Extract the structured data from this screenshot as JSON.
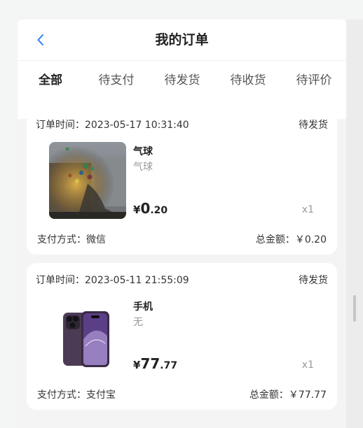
{
  "header": {
    "title": "我的订单",
    "back_icon": "chevron-left-icon"
  },
  "tabs": [
    {
      "label": "全部",
      "active": true
    },
    {
      "label": "待支付",
      "active": false
    },
    {
      "label": "待发货",
      "active": false
    },
    {
      "label": "待收货",
      "active": false
    },
    {
      "label": "待评价",
      "active": false
    }
  ],
  "orders": [
    {
      "time": "订单时间：2023-05-17 10:31:40",
      "status": "待发货",
      "product_name": "气球",
      "product_spec": "气球",
      "price_currency": "¥",
      "price_int": "0",
      "price_dec": ".20",
      "quantity": "x1",
      "payment": "支付方式：微信",
      "total": "总金额：￥0.20"
    },
    {
      "time": "订单时间：2023-05-11 21:55:09",
      "status": "待发货",
      "product_name": "手机",
      "product_spec": "无",
      "price_currency": "¥",
      "price_int": "77",
      "price_dec": ".77",
      "quantity": "x1",
      "payment": "支付方式：支付宝",
      "total": "总金额：￥77.77"
    }
  ],
  "colors": {
    "accent": "#2f7bf0",
    "background": "#f4f4f4",
    "card": "#ffffff"
  }
}
